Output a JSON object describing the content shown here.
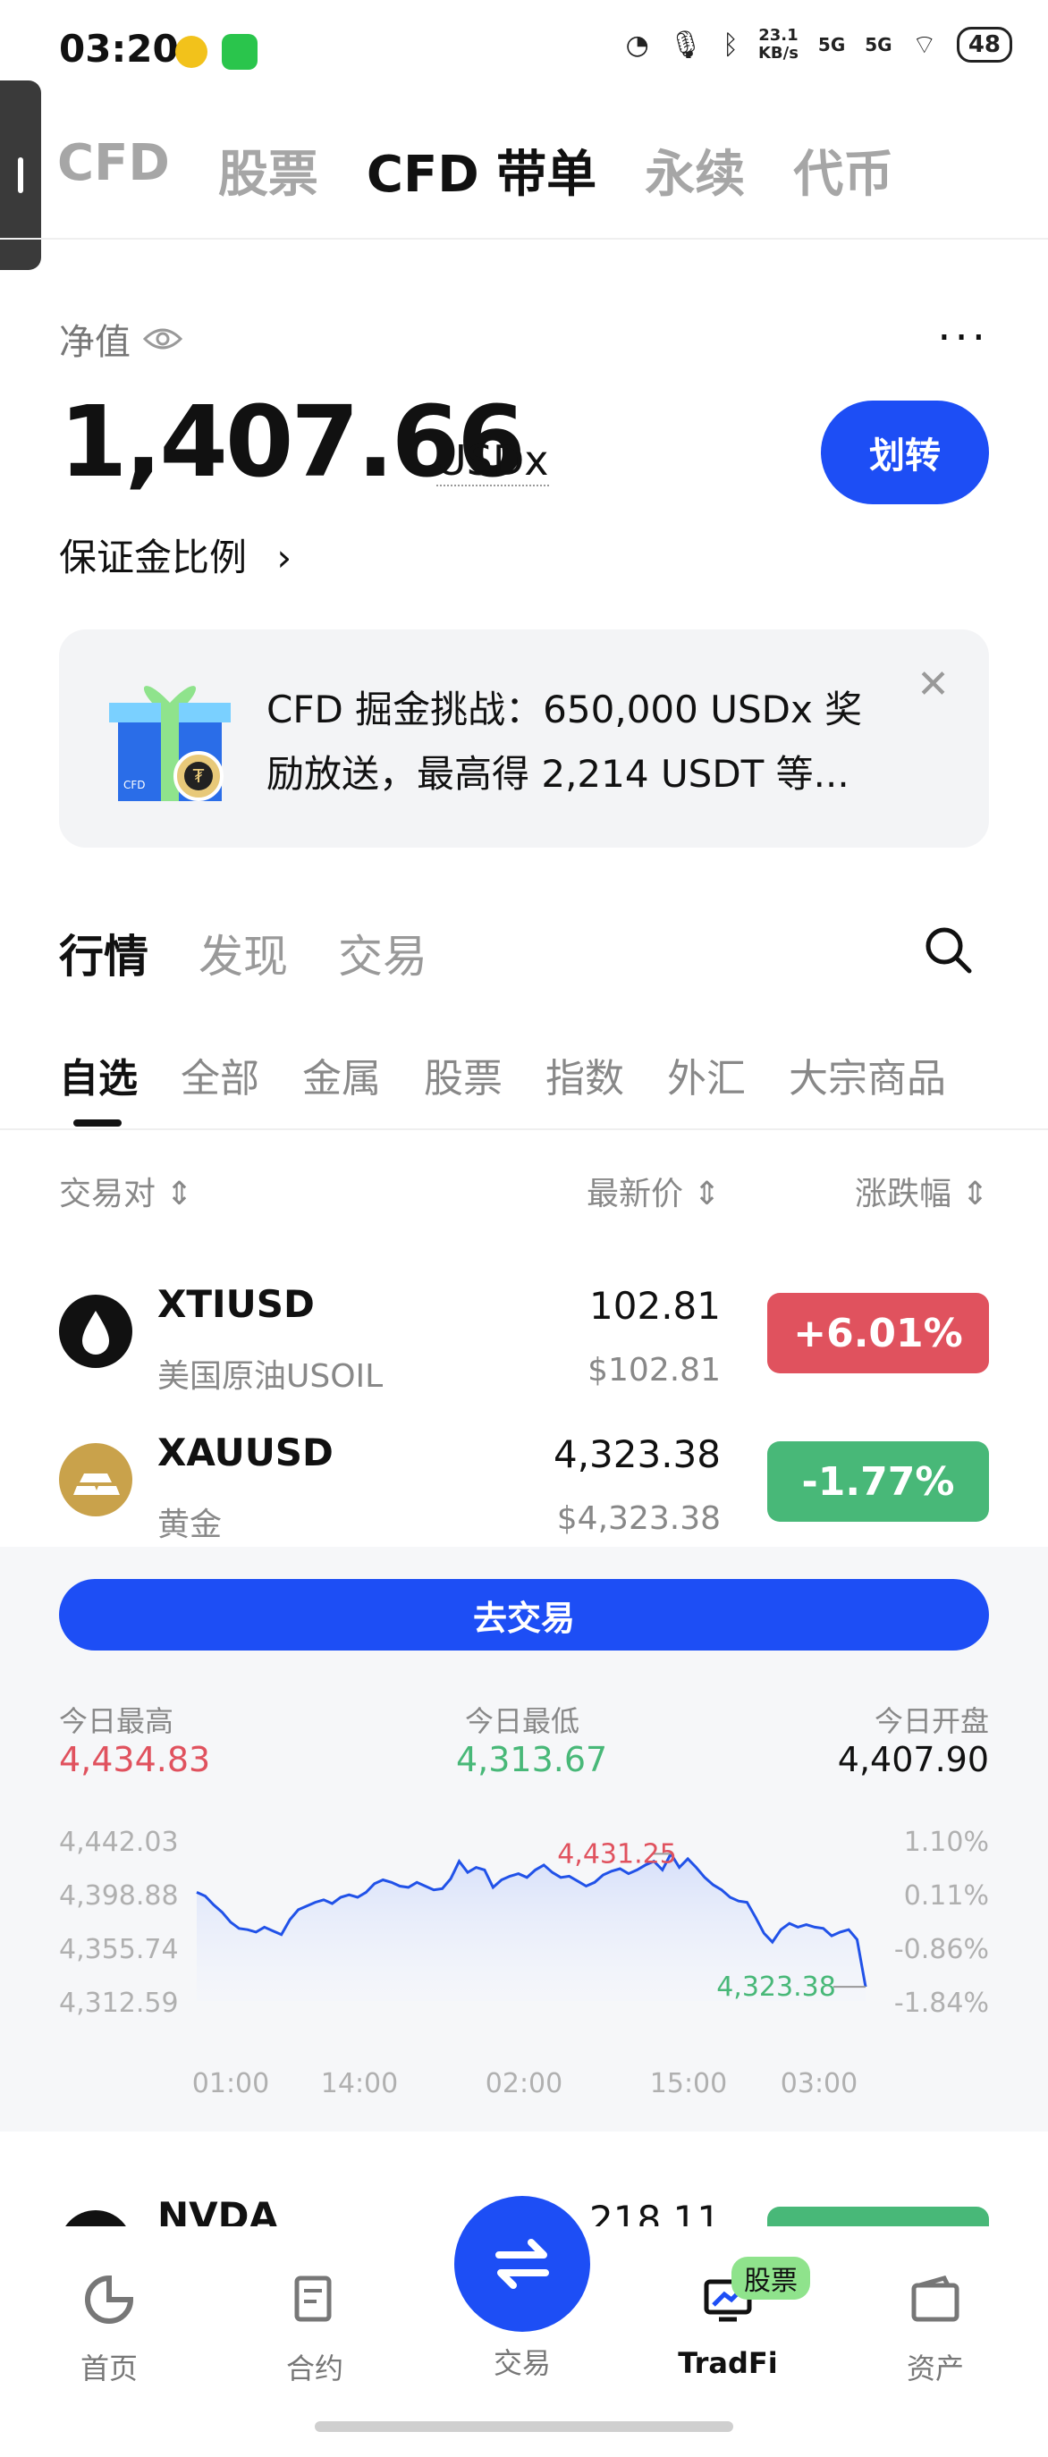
{
  "status_bar": {
    "time": "03:20",
    "net_speed_top": "23.1",
    "net_speed_bottom": "KB/s",
    "signal1": "5G",
    "signal2": "5G",
    "battery": "48"
  },
  "top_tabs": [
    "CFD",
    "股票",
    "CFD 带单",
    "永续",
    "代币"
  ],
  "equity": {
    "label": "净值",
    "value": "1,407.66",
    "unit": "USDx",
    "transfer_label": "划转",
    "margin_link": "保证金比例"
  },
  "promo": {
    "badge": "CFD",
    "line1": "CFD 掘金挑战：650,000 USDx 奖",
    "line2": "励放送，最高得 2,214 USDT 等..."
  },
  "section_tabs": [
    "行情",
    "发现",
    "交易"
  ],
  "category_tabs": [
    "自选",
    "全部",
    "金属",
    "股票",
    "指数",
    "外汇",
    "大宗商品"
  ],
  "table_headers": {
    "pair": "交易对",
    "price": "最新价",
    "change": "涨跌幅"
  },
  "rows": [
    {
      "symbol": "XTIUSD",
      "name": "美国原油USOIL",
      "price": "102.81",
      "price_usd": "$102.81",
      "change": "+6.01%"
    },
    {
      "symbol": "XAUUSD",
      "name": "黄金",
      "price": "4,323.38",
      "price_usd": "$4,323.38",
      "change": "-1.77%"
    },
    {
      "symbol": "NVDA",
      "name": "",
      "price": "218.11",
      "price_usd": "",
      "change": ""
    }
  ],
  "detail": {
    "trade_label": "去交易",
    "high_label": "今日最高",
    "high": "4,434.83",
    "low_label": "今日最低",
    "low": "4,313.67",
    "open_label": "今日开盘",
    "open": "4,407.90"
  },
  "chart_data": {
    "type": "line",
    "y_ticks": [
      "4,442.03",
      "4,398.88",
      "4,355.74",
      "4,312.59"
    ],
    "y_right_ticks": [
      "1.10%",
      "0.11%",
      "-0.86%",
      "-1.84%"
    ],
    "x_ticks": [
      "01:00",
      "14:00",
      "02:00",
      "15:00",
      "03:00"
    ],
    "ylim": [
      4312.59,
      4442.03
    ],
    "max_label": "4,431.25",
    "last_label": "4,323.38",
    "values": [
      4400,
      4397,
      4390,
      4384,
      4376,
      4371,
      4370,
      4368,
      4372,
      4369,
      4366,
      4378,
      4386,
      4389,
      4392,
      4394,
      4391,
      4396,
      4398,
      4396,
      4400,
      4407,
      4410,
      4408,
      4405,
      4404,
      4408,
      4405,
      4402,
      4403,
      4411,
      4425,
      4416,
      4420,
      4418,
      4404,
      4410,
      4413,
      4415,
      4412,
      4418,
      4422,
      4416,
      4412,
      4413,
      4409,
      4405,
      4408,
      4414,
      4417,
      4419,
      4415,
      4418,
      4422,
      4425,
      4418,
      4431,
      4420,
      4427,
      4420,
      4412,
      4406,
      4402,
      4396,
      4393,
      4392,
      4380,
      4367,
      4360,
      4370,
      4375,
      4372,
      4374,
      4372,
      4371,
      4365,
      4368,
      4370,
      4362,
      4324
    ]
  },
  "colors": {
    "accent": "#1d4ef5",
    "up": "#e0525e",
    "down": "#48b878"
  },
  "bottom_nav": [
    {
      "label": "首页",
      "icon": "home-icon"
    },
    {
      "label": "合约",
      "icon": "contract-icon"
    },
    {
      "label": "交易",
      "icon": "swap-icon"
    },
    {
      "label": "TradFi",
      "icon": "tradfi-icon",
      "badge": "股票"
    },
    {
      "label": "资产",
      "icon": "wallet-icon"
    }
  ]
}
